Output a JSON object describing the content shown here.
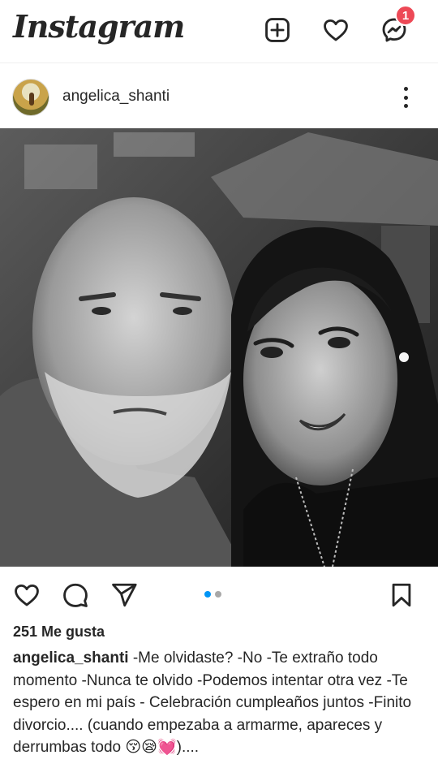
{
  "app": {
    "name": "Instagram"
  },
  "topbar": {
    "icons": [
      "new-post-icon",
      "heart-icon",
      "messenger-icon"
    ],
    "messages_badge": "1"
  },
  "post": {
    "username": "angelica_shanti",
    "photo_description": "",
    "carousel": {
      "count": 2,
      "active_index": 0
    },
    "likes": "251 Me gusta",
    "caption_user": "angelica_shanti",
    "caption_text": " -Me olvidaste? -No -Te extraño todo momento -Nunca te olvido -Podemos intentar otra vez -Te espero en mi país - Celebración cumpleaños juntos -Finito divorcio.... (cuando empezaba a armarme, apareces y derrumbas todo 😚😪💓)....",
    "caption_next": ""
  },
  "colors": {
    "text": "#262626",
    "badge": "#ed4956",
    "carousel_active": "#0095f6",
    "carousel_inactive": "#a8a8a8"
  }
}
